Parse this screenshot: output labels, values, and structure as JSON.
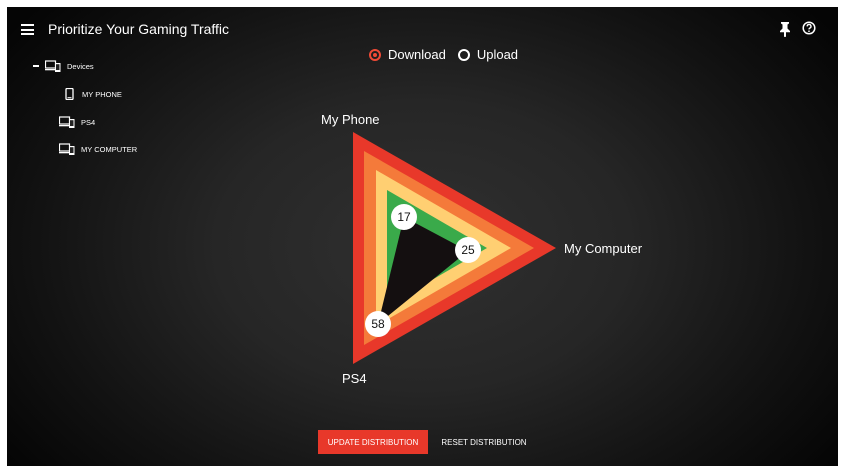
{
  "header": {
    "title": "Prioritize Your Gaming Traffic",
    "menu_icon": "menu-icon",
    "pin_icon": "pin-icon",
    "help_icon": "help-icon"
  },
  "devices_tree": {
    "root_label": "Devices",
    "root_icon": "devices-icon",
    "items": [
      {
        "label": "MY PHONE",
        "icon": "phone-icon"
      },
      {
        "label": "PS4",
        "icon": "devices-icon"
      },
      {
        "label": "MY COMPUTER",
        "icon": "devices-icon"
      }
    ]
  },
  "direction": {
    "options": [
      {
        "label": "Download",
        "selected": true
      },
      {
        "label": "Upload",
        "selected": false
      }
    ]
  },
  "chart_data": {
    "type": "radar",
    "axes": [
      "My Phone",
      "My Computer",
      "PS4"
    ],
    "values": [
      17,
      25,
      58
    ],
    "ring_colors": [
      "#e8382a",
      "#f47a3a",
      "#ffcf72",
      "#3aaa4a"
    ],
    "fill_color": "#140f10"
  },
  "actions": {
    "update_label": "UPDATE DISTRIBUTION",
    "reset_label": "RESET DISTRIBUTION"
  },
  "colors": {
    "accent": "#e8382a"
  }
}
